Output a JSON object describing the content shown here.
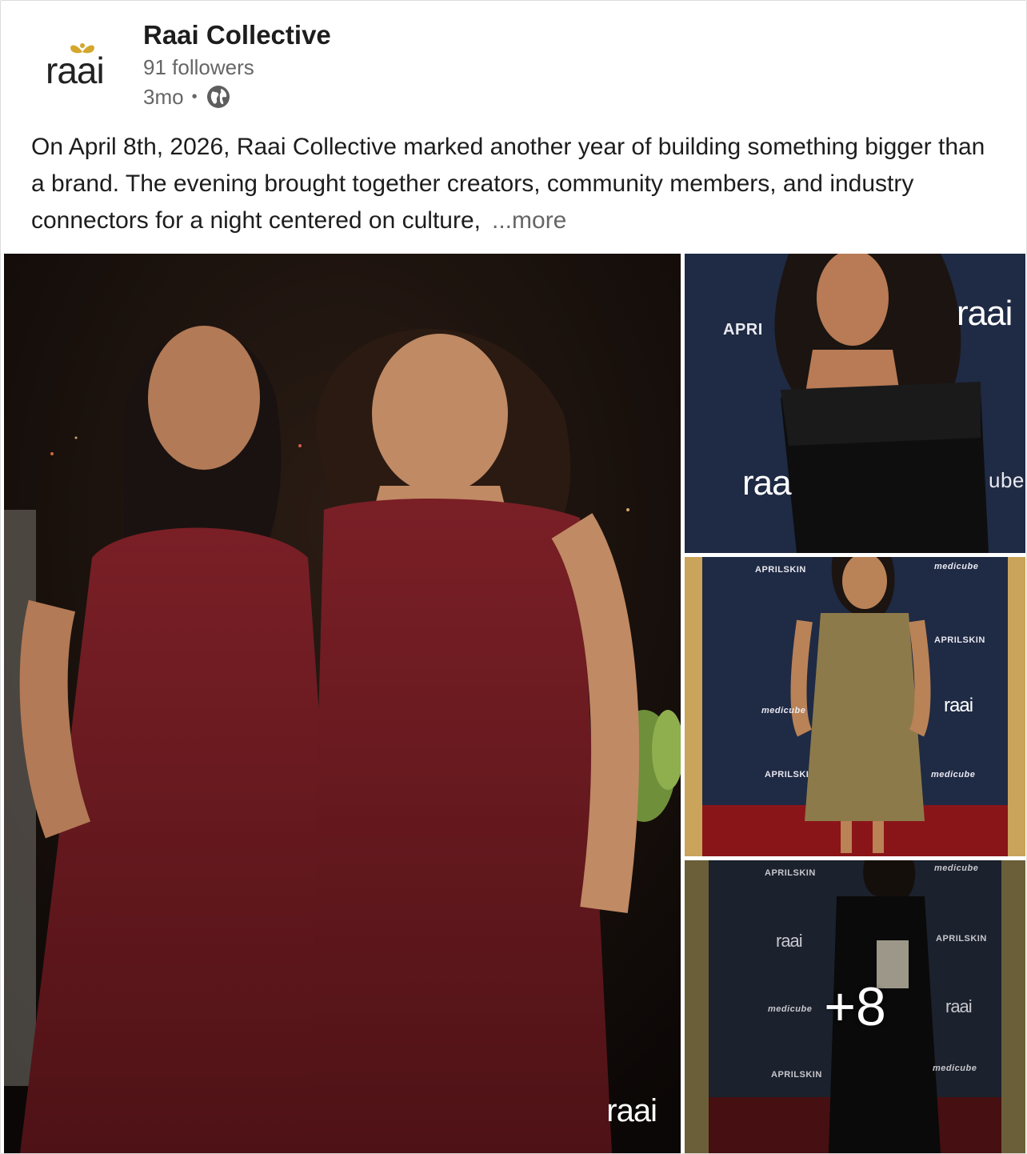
{
  "post": {
    "author": {
      "name": "Raai Collective",
      "followers": "91 followers",
      "time": "3mo",
      "logo_text": "raai",
      "visibility_icon": "globe-icon"
    },
    "text": "On April 8th, 2026, Raai Collective marked another year of building something bigger than a brand. The evening brought together creators, community members, and industry connectors for a night centered on culture,",
    "more_label": "...more",
    "media": {
      "main_watermark": "raai",
      "thumb1_labels": [
        "APRI",
        "raai",
        "raa",
        "ube"
      ],
      "thumb2_labels": [
        "APRILSKIN",
        "medicube",
        "APRILSKIN",
        "raai",
        "medicube",
        "APRILSKI",
        "medicube"
      ],
      "thumb3_labels": [
        "APRILSKIN",
        "medicube",
        "raai",
        "APRILSKIN",
        "medicube",
        "raai",
        "APRILSKIN",
        "medicube"
      ],
      "more_count": "+8"
    }
  },
  "colors": {
    "brand_gold": "#d4a72c",
    "text_primary": "#1d1d1d",
    "text_secondary": "#666666",
    "backdrop_navy": "#1f2a44",
    "dress_maroon": "#6b1a1f"
  }
}
